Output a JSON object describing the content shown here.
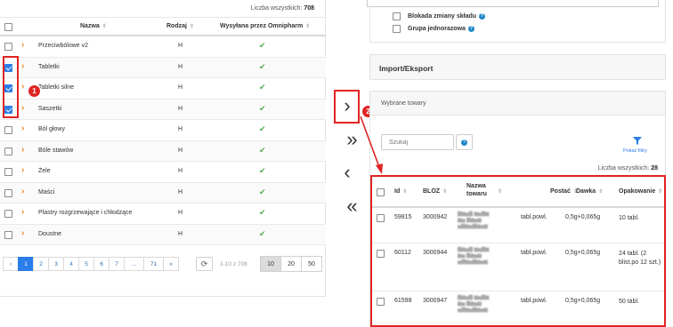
{
  "left": {
    "count_label": "Liczba wszystkich:",
    "count_value": "708",
    "columns": {
      "name": "Nazwa",
      "kind": "Rodzaj",
      "sent": "Wysyłana przez Omnipharm"
    },
    "rows": [
      {
        "name": "Przeciwbólowe v2",
        "kind": "H",
        "sent": "✔",
        "checked": false
      },
      {
        "name": "Tabletki",
        "kind": "H",
        "sent": "✔",
        "checked": true
      },
      {
        "name": "Tabletki silne",
        "kind": "H",
        "sent": "✔",
        "checked": true
      },
      {
        "name": "Saszetki",
        "kind": "H",
        "sent": "✔",
        "checked": true
      },
      {
        "name": "Ból głowy",
        "kind": "H",
        "sent": "✔",
        "checked": false
      },
      {
        "name": "Bóle stawów",
        "kind": "H",
        "sent": "✔",
        "checked": false
      },
      {
        "name": "Żele",
        "kind": "H",
        "sent": "✔",
        "checked": false
      },
      {
        "name": "Maści",
        "kind": "H",
        "sent": "✔",
        "checked": false
      },
      {
        "name": "Plastry rozgrzewające i chłodzące",
        "kind": "H",
        "sent": "✔",
        "checked": false
      },
      {
        "name": "Doustne",
        "kind": "H",
        "sent": "✔",
        "checked": false
      }
    ],
    "pagination": {
      "prev": "‹",
      "pages": [
        "1",
        "2",
        "3",
        "4",
        "5",
        "6",
        "7",
        "...",
        "71"
      ],
      "next": "»",
      "range_text": "1-10 z 708",
      "page_sizes": [
        "10",
        "20",
        "50"
      ],
      "active_page": "1",
      "active_size": "10"
    }
  },
  "annotations": {
    "badge1": "1",
    "badge2": "2",
    "color": "#e02424"
  },
  "transfer": {
    "move_one_right": "›",
    "move_all_right": "»",
    "move_one_left": "‹",
    "move_all_left": "«"
  },
  "right": {
    "option_lock": "Blokada zmiany składu",
    "option_single_group": "Grupa jednorazowa",
    "help_icon": "?",
    "import_export_title": "Import/Eksport",
    "selected_title": "Wybrane towary",
    "search_placeholder": "Szukaj",
    "filter_label": "Pokaż filtry",
    "count_label": "Liczba wszystkich:",
    "count_value": "28",
    "columns": {
      "id": "Id",
      "bloz": "BLOZ",
      "name": "Nazwa towaru",
      "form": "Postać",
      "dose": "Dawka",
      "pack": "Opakowanie"
    },
    "rows": [
      {
        "id": "59815",
        "bloz": "3000942",
        "form": "tabl.powl.",
        "dose": "0,5g+0,065g",
        "pack": "10 tabl."
      },
      {
        "id": "60112",
        "bloz": "3000944",
        "form": "tabl.powl.",
        "dose": "0,5g+0,065g",
        "pack": "24 tabl. (2 blist.po 12 szt.)"
      },
      {
        "id": "61598",
        "bloz": "3000947",
        "form": "tabl.powl.",
        "dose": "0,5g+0,065g",
        "pack": "50 tabl."
      }
    ]
  },
  "colors": {
    "accent": "#2b7de9",
    "chevron": "#e8892b",
    "check_ok": "#4cae4c",
    "annotation": "#e02424"
  }
}
